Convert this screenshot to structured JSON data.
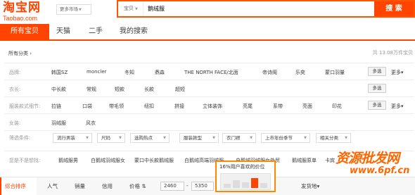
{
  "header": {
    "logo_cn": "淘宝网",
    "logo_en": "Taobao.com",
    "market_label": "更多市场",
    "search_type": "宝贝",
    "search_query": "鹅绒服",
    "search_button": "搜 索"
  },
  "nav": {
    "tabs": [
      "所有宝贝",
      "天猫",
      "二手",
      "我的搜索"
    ]
  },
  "filters": {
    "all_categories": "所有分类",
    "total_count": "共 13.08万件宝贝",
    "multi_label": "多选",
    "more_label": "更多",
    "rows": [
      {
        "label": "品牌:",
        "options": [
          "韩国SZ",
          "moncler",
          "冬知",
          "鼎森",
          "THE NORTH FACE/北面",
          "帝诗阁",
          "乐奕",
          "蒙口羽量"
        ]
      },
      {
        "label": "衣长:",
        "options": [
          "中长款",
          "常规",
          "短款",
          "长款",
          "超短"
        ]
      },
      {
        "label": "服装款式细节:",
        "options": [
          "拉链",
          "口袋",
          "带毛领",
          "纽扣",
          "拼接",
          "立体装饰",
          "亮尾",
          "系带",
          "亮面",
          "印花"
        ]
      },
      {
        "label": "女装:",
        "options": [
          "羽绒服",
          "风衣"
        ]
      }
    ],
    "select_label": "筛选条件:",
    "dropdowns": [
      "流行男装",
      "尺码",
      "选购热点",
      "服装款型",
      "衣门襟",
      "上市年份季节",
      "相关分类"
    ]
  },
  "suggestions": {
    "label": "您是不是想找:",
    "items": [
      "鹅绒服男",
      "白鹅绒羽绒服女",
      "蒙口中长款鹅绒服",
      "白鹅绒高端羽绒服",
      "白鹅绒羽绒服女外贸",
      "鹅绒服原单",
      "卡宾"
    ]
  },
  "sortbar": {
    "items": [
      "综合排序",
      "人气",
      "销量",
      "信用",
      "价格"
    ],
    "price_min": "2460",
    "price_max": "5350",
    "ship_from": "发货地"
  },
  "price_tip": {
    "text": "16%用户喜欢的价位",
    "histogram": [
      0.3,
      0.55,
      0.4,
      0.7,
      0.35
    ]
  },
  "watermark": {
    "main": "资源批发网",
    "sub": "www.6pf.cn"
  },
  "colors": {
    "brand": "#ff4400"
  }
}
